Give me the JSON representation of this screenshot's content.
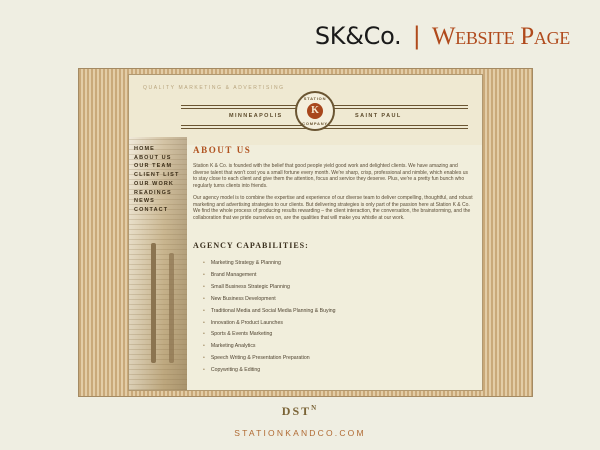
{
  "slide": {
    "title_main": "SK&Co.",
    "title_sep": "|",
    "title_sub": "Website Page"
  },
  "site": {
    "tagline": "QUALITY MARKETING & ADVERTISING",
    "city_left": "MINNEAPOLIS",
    "city_right": "SAINT PAUL",
    "logo": {
      "text_top": "STATION",
      "letter": "K",
      "text_bottom": "COMPANY"
    },
    "nav": [
      "HOME",
      "ABOUT US",
      "OUR TEAM",
      "CLIENT LIST",
      "OUR WORK",
      "READINGS",
      "NEWS",
      "CONTACT"
    ],
    "about_heading": "ABOUT US",
    "about_para1": "Station K & Co. is founded with the belief that good people yield good work and delighted clients.  We have amazing and diverse talent that won't cost you a small fortune every month. We're sharp, crisp, professional and nimble, which enables us to stay close to each client and give them the attention, focus and service they deserve.  Plus, we're a pretty fun bunch who regularly turns clients into friends.",
    "about_para2": "Our agency model is to combine the expertise and experience of our diverse team to deliver compelling, thoughtful, and robust marketing and advertising strategies to our clients. But delivering strategies is only part of the passion here at Station K & Co.  We find the whole process of producing results rewarding – the client interaction, the conversation, the brainstorming, and the collaboration that we pride ourselves on, are the qualities that will make you whistle at our work.",
    "capabilities_heading": "AGENCY CAPABILITIES:",
    "capabilities": [
      "Marketing Strategy & Planning",
      "Brand Management",
      "Small Business Strategic Planning",
      "New Business Development",
      "Traditional Media and Social Media Planning & Buying",
      "Innovation & Product Launches",
      "Sports & Events Marketing",
      "Marketing Analytics",
      "Speech Writing & Presentation Preparation",
      "Copywriting & Editing"
    ],
    "bullet": "•"
  },
  "footer": {
    "mark": "DST",
    "mark_sup": "N",
    "url": "STATIONKANDCO.COM"
  }
}
